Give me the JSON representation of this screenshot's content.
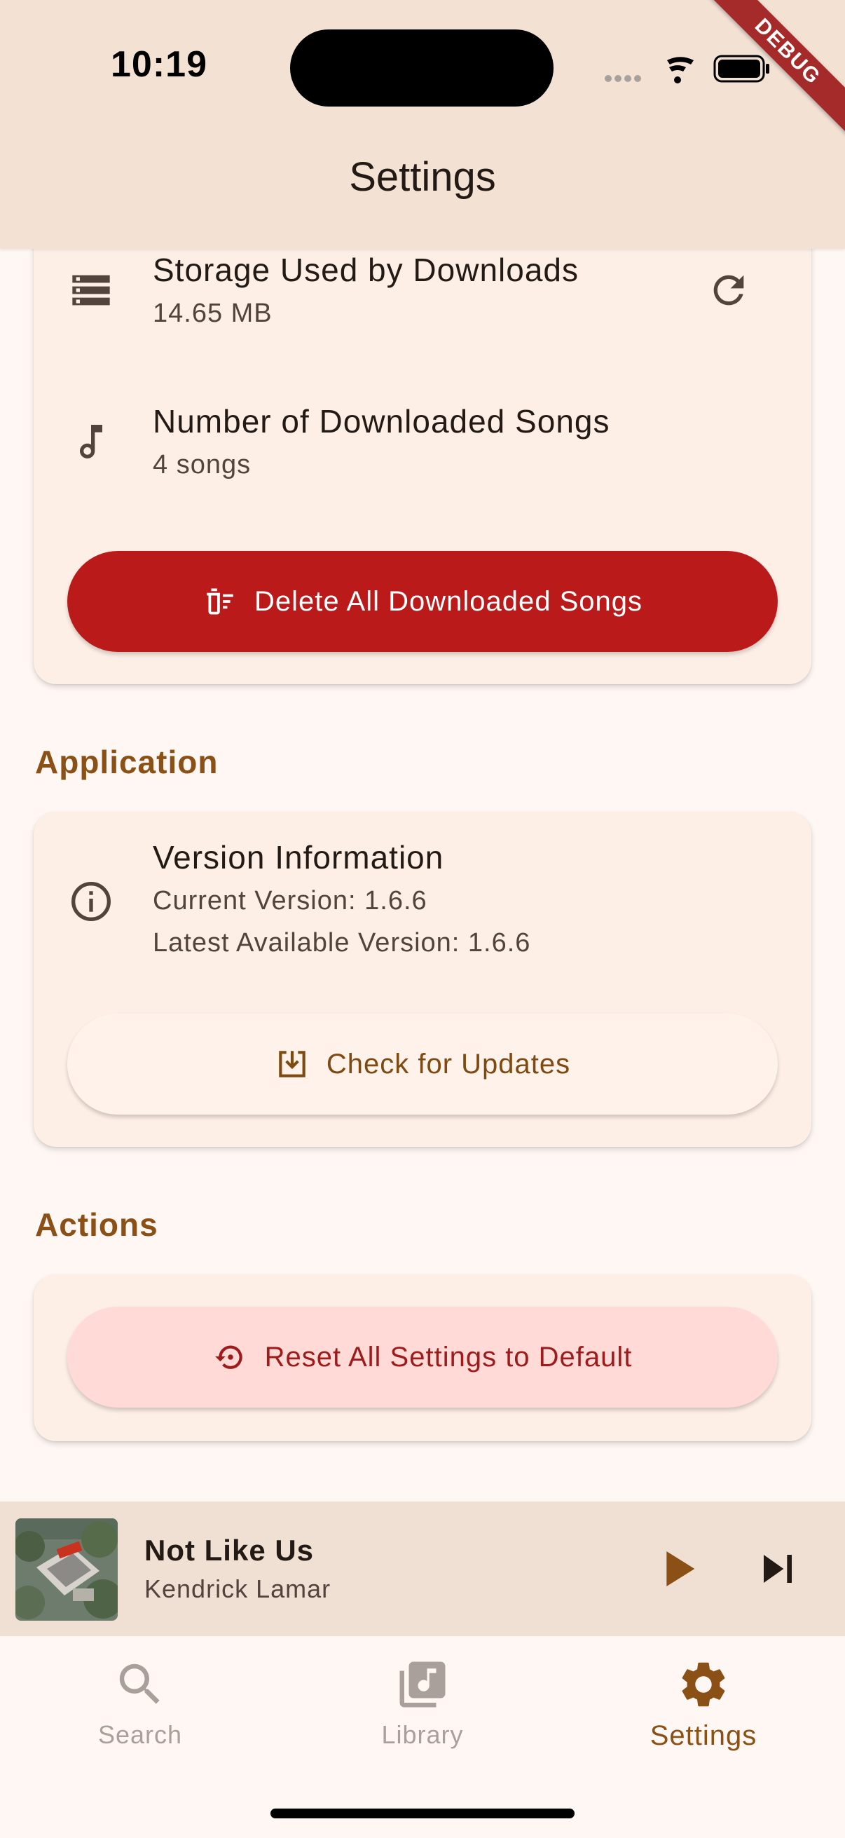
{
  "status_bar": {
    "time": "10:19",
    "debug_label": "DEBUG"
  },
  "app_bar": {
    "title": "Settings"
  },
  "downloads": {
    "storage": {
      "label": "Storage Used by Downloads",
      "value": "14.65 MB"
    },
    "songs": {
      "label": "Number of Downloaded Songs",
      "value": "4 songs"
    },
    "delete_button": "Delete All Downloaded Songs"
  },
  "application": {
    "header": "Application",
    "version": {
      "label": "Version Information",
      "current": "Current Version: 1.6.6",
      "latest": "Latest Available Version: 1.6.6"
    },
    "check_button": "Check for Updates"
  },
  "actions": {
    "header": "Actions",
    "reset_button": "Reset All Settings to Default"
  },
  "mini_player": {
    "title": "Not Like Us",
    "artist": "Kendrick Lamar"
  },
  "nav": {
    "items": [
      {
        "label": "Search",
        "icon": "search-icon",
        "active": false
      },
      {
        "label": "Library",
        "icon": "library-music-icon",
        "active": false
      },
      {
        "label": "Settings",
        "icon": "gear-icon",
        "active": true
      }
    ]
  },
  "colors": {
    "primary": "#8B5016",
    "danger": "#BA1A1A",
    "surface": "#FFF7F3",
    "card": "#FDEFE6",
    "nav_inactive": "#9A8F89"
  }
}
